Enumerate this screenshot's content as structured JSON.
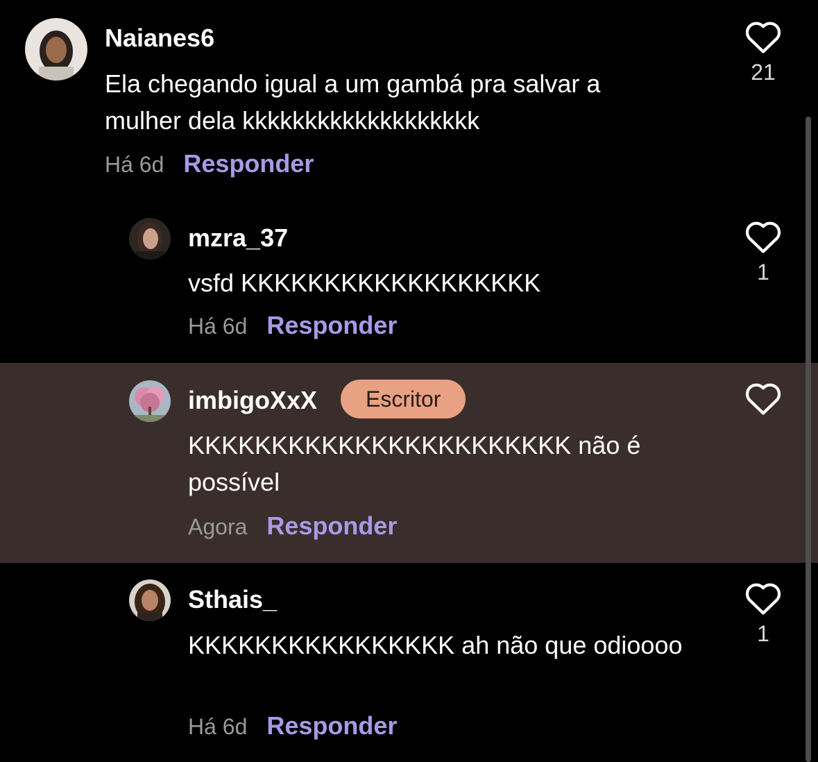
{
  "comments": [
    {
      "username": "Naianes6",
      "text": "Ela chegando igual a um gambá pra salvar a mulher dela kkkkkkkkkkkkkkkkkkk",
      "time": "Há 6d",
      "reply_label": "Responder",
      "likes": "21",
      "avatar_icon": "avatar-photo"
    },
    {
      "username": "mzra_37",
      "text": "vsfd KKKKKKKKKKKKKKKKKK",
      "time": "Há 6d",
      "reply_label": "Responder",
      "likes": "1",
      "avatar_icon": "avatar-photo"
    },
    {
      "username": "imbigoXxX",
      "badge": "Escritor",
      "text": "KKKKKKKKKKKKKKKKKKKKKKK não é possível",
      "time": "Agora",
      "reply_label": "Responder",
      "likes": "",
      "avatar_icon": "avatar-photo"
    },
    {
      "username": "Sthais_",
      "text": "KKKKKKKKKKKKKKKK ah não que odioooo",
      "time": "Há 6d",
      "reply_label": "Responder",
      "likes": "1",
      "avatar_icon": "avatar-photo"
    }
  ],
  "icons": {
    "like": "heart-outline-icon"
  },
  "colors": {
    "background": "#000000",
    "highlight_background": "#3a2e2c",
    "reply_accent": "#a89ae6",
    "badge_background": "#e8a183",
    "time_text": "#9a9a9a"
  }
}
